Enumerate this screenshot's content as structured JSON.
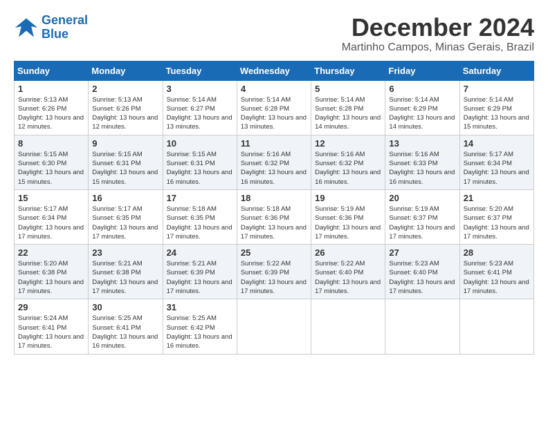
{
  "header": {
    "logo_line1": "General",
    "logo_line2": "Blue",
    "month_title": "December 2024",
    "location": "Martinho Campos, Minas Gerais, Brazil"
  },
  "days_of_week": [
    "Sunday",
    "Monday",
    "Tuesday",
    "Wednesday",
    "Thursday",
    "Friday",
    "Saturday"
  ],
  "weeks": [
    [
      {
        "day": "1",
        "sunrise": "5:13 AM",
        "sunset": "6:26 PM",
        "daylight": "13 hours and 12 minutes."
      },
      {
        "day": "2",
        "sunrise": "5:13 AM",
        "sunset": "6:26 PM",
        "daylight": "13 hours and 12 minutes."
      },
      {
        "day": "3",
        "sunrise": "5:14 AM",
        "sunset": "6:27 PM",
        "daylight": "13 hours and 13 minutes."
      },
      {
        "day": "4",
        "sunrise": "5:14 AM",
        "sunset": "6:28 PM",
        "daylight": "13 hours and 13 minutes."
      },
      {
        "day": "5",
        "sunrise": "5:14 AM",
        "sunset": "6:28 PM",
        "daylight": "13 hours and 14 minutes."
      },
      {
        "day": "6",
        "sunrise": "5:14 AM",
        "sunset": "6:29 PM",
        "daylight": "13 hours and 14 minutes."
      },
      {
        "day": "7",
        "sunrise": "5:14 AM",
        "sunset": "6:29 PM",
        "daylight": "13 hours and 15 minutes."
      }
    ],
    [
      {
        "day": "8",
        "sunrise": "5:15 AM",
        "sunset": "6:30 PM",
        "daylight": "13 hours and 15 minutes."
      },
      {
        "day": "9",
        "sunrise": "5:15 AM",
        "sunset": "6:31 PM",
        "daylight": "13 hours and 15 minutes."
      },
      {
        "day": "10",
        "sunrise": "5:15 AM",
        "sunset": "6:31 PM",
        "daylight": "13 hours and 16 minutes."
      },
      {
        "day": "11",
        "sunrise": "5:16 AM",
        "sunset": "6:32 PM",
        "daylight": "13 hours and 16 minutes."
      },
      {
        "day": "12",
        "sunrise": "5:16 AM",
        "sunset": "6:32 PM",
        "daylight": "13 hours and 16 minutes."
      },
      {
        "day": "13",
        "sunrise": "5:16 AM",
        "sunset": "6:33 PM",
        "daylight": "13 hours and 16 minutes."
      },
      {
        "day": "14",
        "sunrise": "5:17 AM",
        "sunset": "6:34 PM",
        "daylight": "13 hours and 17 minutes."
      }
    ],
    [
      {
        "day": "15",
        "sunrise": "5:17 AM",
        "sunset": "6:34 PM",
        "daylight": "13 hours and 17 minutes."
      },
      {
        "day": "16",
        "sunrise": "5:17 AM",
        "sunset": "6:35 PM",
        "daylight": "13 hours and 17 minutes."
      },
      {
        "day": "17",
        "sunrise": "5:18 AM",
        "sunset": "6:35 PM",
        "daylight": "13 hours and 17 minutes."
      },
      {
        "day": "18",
        "sunrise": "5:18 AM",
        "sunset": "6:36 PM",
        "daylight": "13 hours and 17 minutes."
      },
      {
        "day": "19",
        "sunrise": "5:19 AM",
        "sunset": "6:36 PM",
        "daylight": "13 hours and 17 minutes."
      },
      {
        "day": "20",
        "sunrise": "5:19 AM",
        "sunset": "6:37 PM",
        "daylight": "13 hours and 17 minutes."
      },
      {
        "day": "21",
        "sunrise": "5:20 AM",
        "sunset": "6:37 PM",
        "daylight": "13 hours and 17 minutes."
      }
    ],
    [
      {
        "day": "22",
        "sunrise": "5:20 AM",
        "sunset": "6:38 PM",
        "daylight": "13 hours and 17 minutes."
      },
      {
        "day": "23",
        "sunrise": "5:21 AM",
        "sunset": "6:38 PM",
        "daylight": "13 hours and 17 minutes."
      },
      {
        "day": "24",
        "sunrise": "5:21 AM",
        "sunset": "6:39 PM",
        "daylight": "13 hours and 17 minutes."
      },
      {
        "day": "25",
        "sunrise": "5:22 AM",
        "sunset": "6:39 PM",
        "daylight": "13 hours and 17 minutes."
      },
      {
        "day": "26",
        "sunrise": "5:22 AM",
        "sunset": "6:40 PM",
        "daylight": "13 hours and 17 minutes."
      },
      {
        "day": "27",
        "sunrise": "5:23 AM",
        "sunset": "6:40 PM",
        "daylight": "13 hours and 17 minutes."
      },
      {
        "day": "28",
        "sunrise": "5:23 AM",
        "sunset": "6:41 PM",
        "daylight": "13 hours and 17 minutes."
      }
    ],
    [
      {
        "day": "29",
        "sunrise": "5:24 AM",
        "sunset": "6:41 PM",
        "daylight": "13 hours and 17 minutes."
      },
      {
        "day": "30",
        "sunrise": "5:25 AM",
        "sunset": "6:41 PM",
        "daylight": "13 hours and 16 minutes."
      },
      {
        "day": "31",
        "sunrise": "5:25 AM",
        "sunset": "6:42 PM",
        "daylight": "13 hours and 16 minutes."
      },
      null,
      null,
      null,
      null
    ]
  ]
}
